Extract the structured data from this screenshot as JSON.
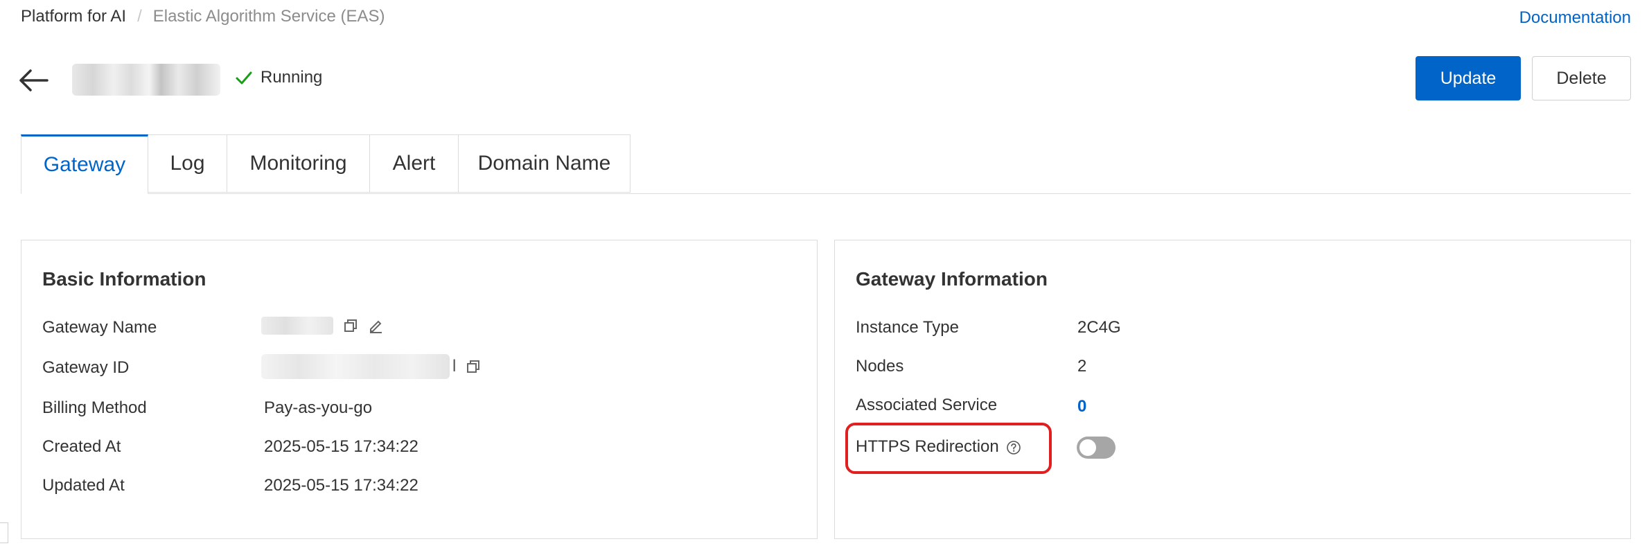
{
  "breadcrumb": {
    "items": [
      "Platform for AI",
      "Elastic Algorithm Service (EAS)"
    ],
    "separator": "/"
  },
  "header": {
    "documentation_label": "Documentation",
    "status_text": "Running",
    "status_color": "#1a9d1a",
    "update_label": "Update",
    "delete_label": "Delete"
  },
  "tabs": [
    {
      "label": "Gateway",
      "active": true
    },
    {
      "label": "Log"
    },
    {
      "label": "Monitoring"
    },
    {
      "label": "Alert"
    },
    {
      "label": "Domain Name"
    }
  ],
  "basic_info": {
    "title": "Basic Information",
    "gateway_name_label": "Gateway Name",
    "gateway_id_label": "Gateway ID",
    "gateway_id_suffix": "l",
    "billing_method_label": "Billing Method",
    "billing_method_value": "Pay-as-you-go",
    "created_at_label": "Created At",
    "created_at_value": "2025-05-15 17:34:22",
    "updated_at_label": "Updated At",
    "updated_at_value": "2025-05-15 17:34:22"
  },
  "gateway_info": {
    "title": "Gateway Information",
    "instance_type_label": "Instance Type",
    "instance_type_value": "2C4G",
    "nodes_label": "Nodes",
    "nodes_value": "2",
    "associated_service_label": "Associated Service",
    "associated_service_value": "0",
    "https_redirection_label": "HTTPS Redirection",
    "https_redirection_enabled": false
  },
  "colors": {
    "primary": "#0064c8",
    "highlight": "#e02020",
    "toggle_off": "#a6a6a6"
  }
}
